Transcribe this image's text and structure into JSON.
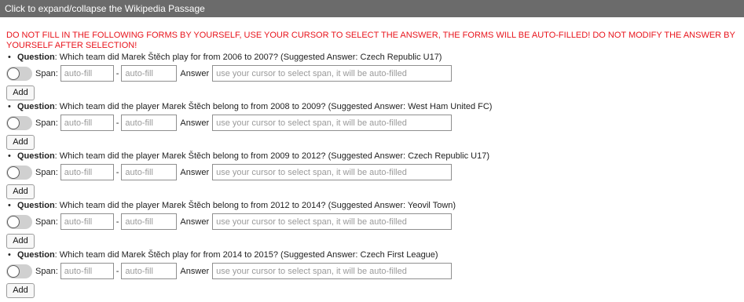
{
  "banner": {
    "text": "Click to expand/collapse the Wikipedia Passage"
  },
  "warning": "DO NOT FILL IN THE FOLLOWING FORMS BY YOURSELF, USE YOUR CURSOR TO SELECT THE ANSWER, THE FORMS WILL BE AUTO-FILLED! DO NOT MODIFY THE ANSWER BY YOURSELF AFTER SELECTION!",
  "labels": {
    "bullet": "•",
    "question": "Question",
    "span": "Span:",
    "dash": "-",
    "answer": "Answer",
    "add": "Add"
  },
  "placeholders": {
    "span_start": "auto-fill",
    "span_end": "auto-fill",
    "answer": "use your cursor to select span, it will be auto-filled"
  },
  "questions": [
    {
      "text": ": Which team did Marek Štěch play for from 2006 to 2007? (Suggested Answer: Czech Republic U17)"
    },
    {
      "text": ": Which team did the player Marek Štěch belong to from 2008 to 2009? (Suggested Answer: West Ham United FC)"
    },
    {
      "text": ": Which team did the player Marek Štěch belong to from 2009 to 2012? (Suggested Answer: Czech Republic U17)"
    },
    {
      "text": ": Which team did the player Marek Štěch belong to from 2012 to 2014? (Suggested Answer: Yeovil Town)"
    },
    {
      "text": ": Which team did Marek Štěch play for from 2014 to 2015? (Suggested Answer: Czech First League)"
    }
  ]
}
